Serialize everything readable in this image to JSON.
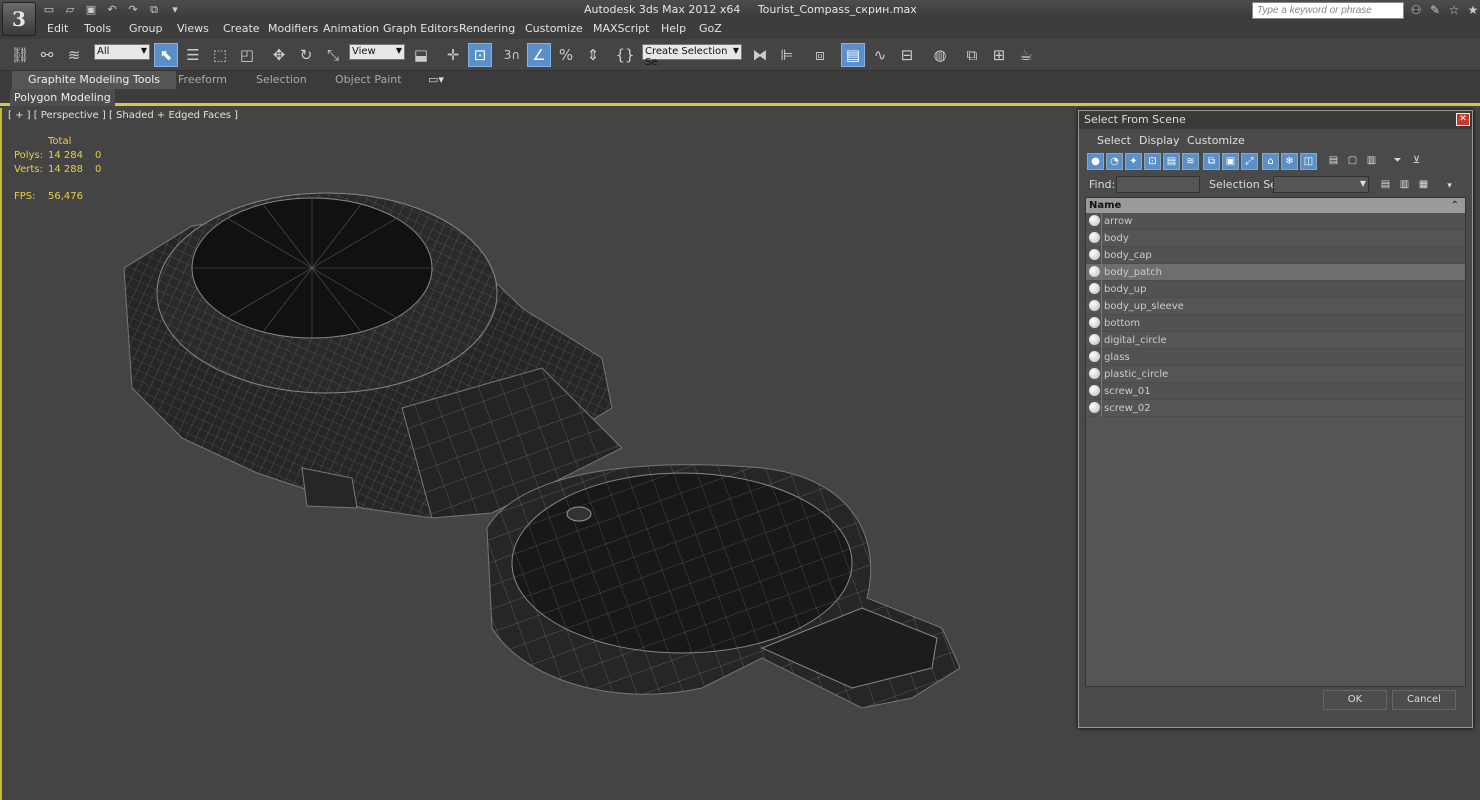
{
  "window": {
    "app_title": "Autodesk 3ds Max  2012 x64",
    "file_name": "Tourist_Compass_скрин.max",
    "search_placeholder": "Type a keyword or phrase"
  },
  "menubar": [
    "Edit",
    "Tools",
    "Group",
    "Views",
    "Create",
    "Modifiers",
    "Animation",
    "Graph Editors",
    "Rendering",
    "Customize",
    "MAXScript",
    "Help",
    "GoZ"
  ],
  "toolbar": {
    "selection_filter": "All",
    "reference_coord": "View",
    "snap_value": "3",
    "named_selection": "Create Selection Se"
  },
  "ribbon": {
    "tabs": [
      "Graphite Modeling Tools",
      "Freeform",
      "Selection",
      "Object Paint"
    ],
    "panel": "Polygon Modeling"
  },
  "viewport": {
    "label": "[ + ] [ Perspective ] [ Shaded + Edged Faces ]",
    "stats": {
      "total_header": "Total",
      "polys_label": "Polys:",
      "polys_total": "14 284",
      "polys_sel": "0",
      "verts_label": "Verts:",
      "verts_total": "14 288",
      "verts_sel": "0",
      "fps_label": "FPS:",
      "fps_value": "56,476"
    }
  },
  "dialog": {
    "title": "Select From Scene",
    "menu": [
      "Select",
      "Display",
      "Customize"
    ],
    "find_label": "Find:",
    "selection_set_label": "Selection Set:",
    "column_name": "Name",
    "objects": [
      "arrow",
      "body",
      "body_cap",
      "body_patch",
      "body_up",
      "body_up_sleeve",
      "bottom",
      "digital_circle",
      "glass",
      "plastic_circle",
      "screw_01",
      "screw_02"
    ],
    "selected_object": "body_patch",
    "ok_label": "OK",
    "cancel_label": "Cancel"
  },
  "colors": {
    "accent_yellow": "#d4c84a",
    "stats_yellow": "#e8d040",
    "active_blue": "#5b8fc7",
    "background": "#444444"
  }
}
